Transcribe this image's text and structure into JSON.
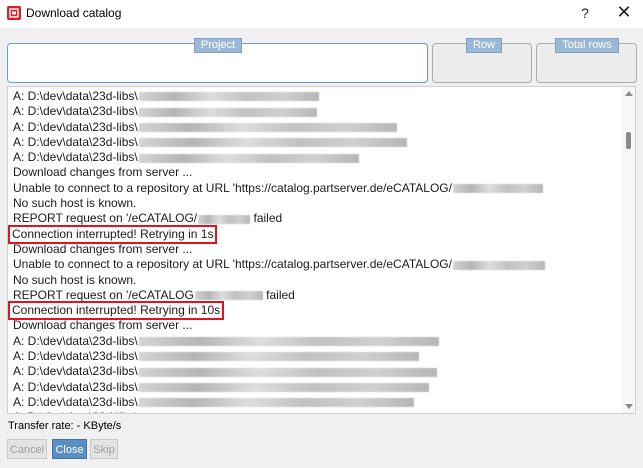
{
  "window": {
    "title": "Download catalog",
    "help_label": "?",
    "close_label": "✕"
  },
  "groups": {
    "project": "Project",
    "row": "Row",
    "total_rows": "Total rows"
  },
  "log": {
    "lines": [
      {
        "text": "A: D:\\dev\\data\\23d-libs\\",
        "redacted": true,
        "redact_len": 180,
        "highlight": false
      },
      {
        "text": "A: D:\\dev\\data\\23d-libs\\",
        "redacted": true,
        "redact_len": 178,
        "highlight": false
      },
      {
        "text": "A: D:\\dev\\data\\23d-libs\\",
        "redacted": true,
        "redact_len": 258,
        "highlight": false
      },
      {
        "text": "A: D:\\dev\\data\\23d-libs\\",
        "redacted": true,
        "redact_len": 268,
        "highlight": false
      },
      {
        "text": "A: D:\\dev\\data\\23d-libs\\",
        "redacted": true,
        "redact_len": 220,
        "highlight": false
      },
      {
        "text": "Download changes from server ...",
        "redacted": false,
        "highlight": false
      },
      {
        "text": "Unable to connect to a repository at URL 'https://catalog.partserver.de/eCATALOG/",
        "redacted": true,
        "redact_len": 90,
        "highlight": false
      },
      {
        "text": "No such host is known.",
        "redacted": false,
        "highlight": false
      },
      {
        "text": "REPORT request on '/eCATALOG/",
        "redacted": true,
        "redact_len": 52,
        "suffix": " failed",
        "highlight": false
      },
      {
        "text": "Connection interrupted! Retrying in 1s",
        "redacted": false,
        "highlight": true
      },
      {
        "text": "Download changes from server ...",
        "redacted": false,
        "highlight": false
      },
      {
        "text": "Unable to connect to a repository at URL 'https://catalog.partserver.de/eCATALOG/",
        "redacted": true,
        "redact_len": 92,
        "highlight": false
      },
      {
        "text": "No such host is known.",
        "redacted": false,
        "highlight": false
      },
      {
        "text": "REPORT request on '/eCATALOG",
        "redacted": true,
        "redact_len": 68,
        "suffix": " failed",
        "highlight": false
      },
      {
        "text": "Connection interrupted! Retrying in 10s",
        "redacted": false,
        "highlight": true
      },
      {
        "text": "Download changes from server ...",
        "redacted": false,
        "highlight": false
      },
      {
        "text": "A: D:\\dev\\data\\23d-libs\\",
        "redacted": true,
        "redact_len": 300,
        "highlight": false
      },
      {
        "text": "A: D:\\dev\\data\\23d-libs\\",
        "redacted": true,
        "redact_len": 280,
        "highlight": false
      },
      {
        "text": "A: D:\\dev\\data\\23d-libs\\",
        "redacted": true,
        "redact_len": 298,
        "highlight": false
      },
      {
        "text": "A: D:\\dev\\data\\23d-libs\\",
        "redacted": true,
        "redact_len": 290,
        "highlight": false
      },
      {
        "text": "A: D:\\dev\\data\\23d-libs\\",
        "redacted": true,
        "redact_len": 275,
        "highlight": false
      },
      {
        "text": "A: D:\\dev\\data\\23d-libs\\",
        "redacted": true,
        "redact_len": 296,
        "highlight": false
      }
    ]
  },
  "status": {
    "transfer_rate": "Transfer rate: - KByte/s"
  },
  "buttons": {
    "cancel": "Cancel",
    "close": "Close",
    "skip": "Skip"
  },
  "colors": {
    "highlight_border": "#e0141e",
    "accent": "#5a8fc4",
    "app_icon": "#d6202a"
  }
}
